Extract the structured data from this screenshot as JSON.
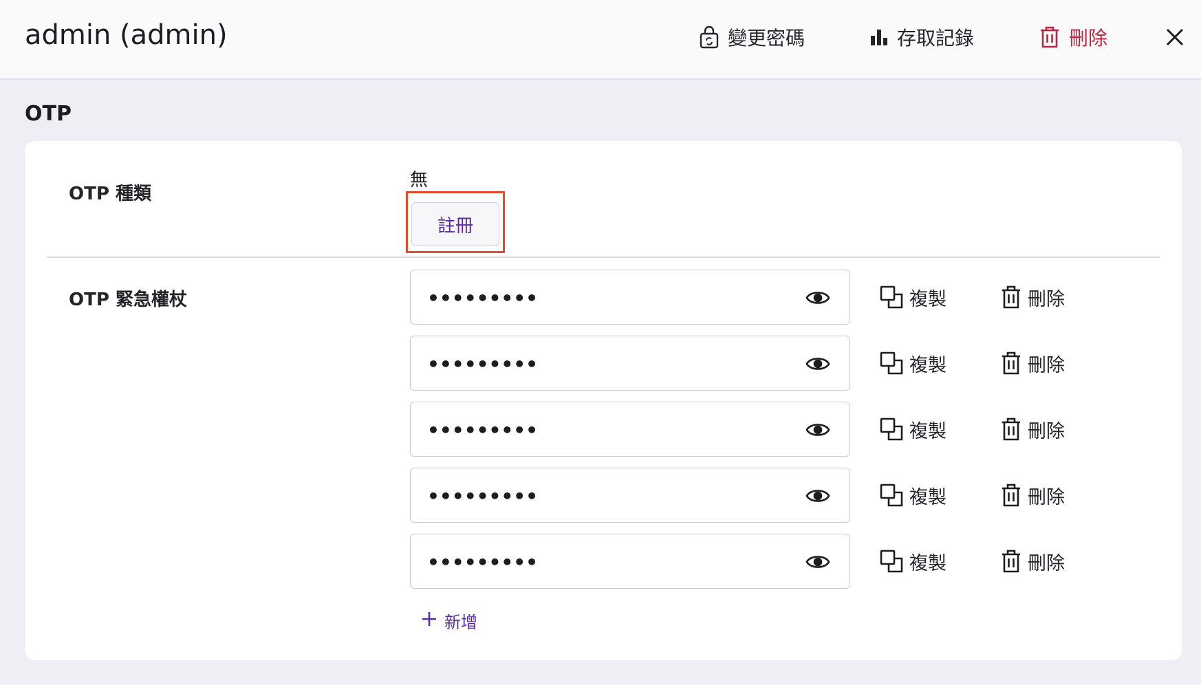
{
  "header": {
    "title": "admin (admin)",
    "change_password_label": "變更密碼",
    "access_log_label": "存取記錄",
    "delete_label": "刪除",
    "danger_color": "#c1253e"
  },
  "section": {
    "title": "OTP"
  },
  "otp_type": {
    "label": "OTP 種類",
    "value": "無",
    "register_label": "註冊"
  },
  "otp_codes": {
    "label": "OTP 緊急權杖",
    "masked_value": "•••••••••",
    "copy_label": "複製",
    "delete_label": "刪除",
    "add_label": "新增",
    "accent_color": "#5b2ca8"
  }
}
